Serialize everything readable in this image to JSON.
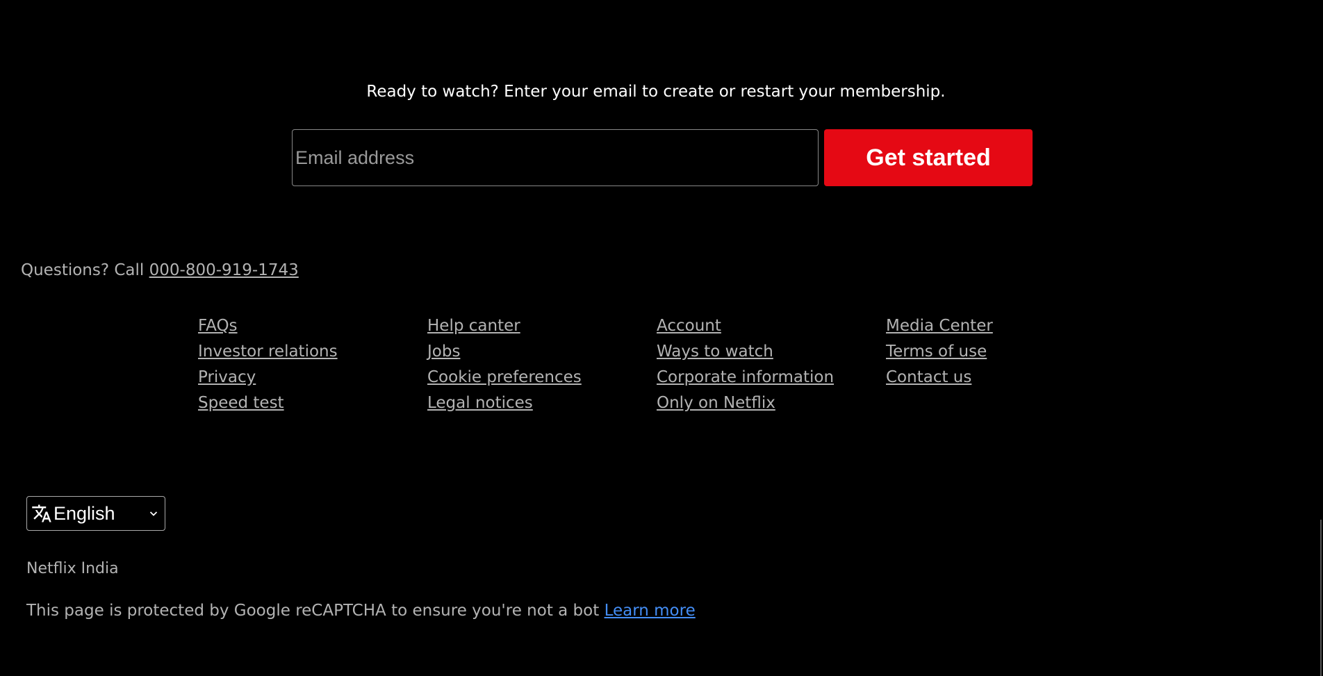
{
  "cta": {
    "prompt": "Ready to watch? Enter your email to create or restart your membership.",
    "email_placeholder": "Email address",
    "button_label": "Get started"
  },
  "questions": {
    "text": "Questions? Call ",
    "phone": "000-800-919-1743"
  },
  "footer_links": [
    "FAQs",
    "Help canter",
    "Account",
    "Media Center",
    "Investor relations",
    "Jobs",
    "Ways to watch",
    "Terms of use",
    "Privacy",
    "Cookie preferences",
    "Corporate information",
    "Contact us",
    "Speed test",
    "Legal notices",
    "Only on Netflix"
  ],
  "language": {
    "selected": "English",
    "icon": "translate-icon"
  },
  "region": "Netflix India",
  "recaptcha": {
    "text": "This page is protected by Google reCAPTCHA to ensure you're not a bot ",
    "link": "Learn more"
  },
  "colors": {
    "background": "#000000",
    "accent": "#e50914",
    "link": "#448ef6",
    "muted_text": "#b3b3b3"
  }
}
